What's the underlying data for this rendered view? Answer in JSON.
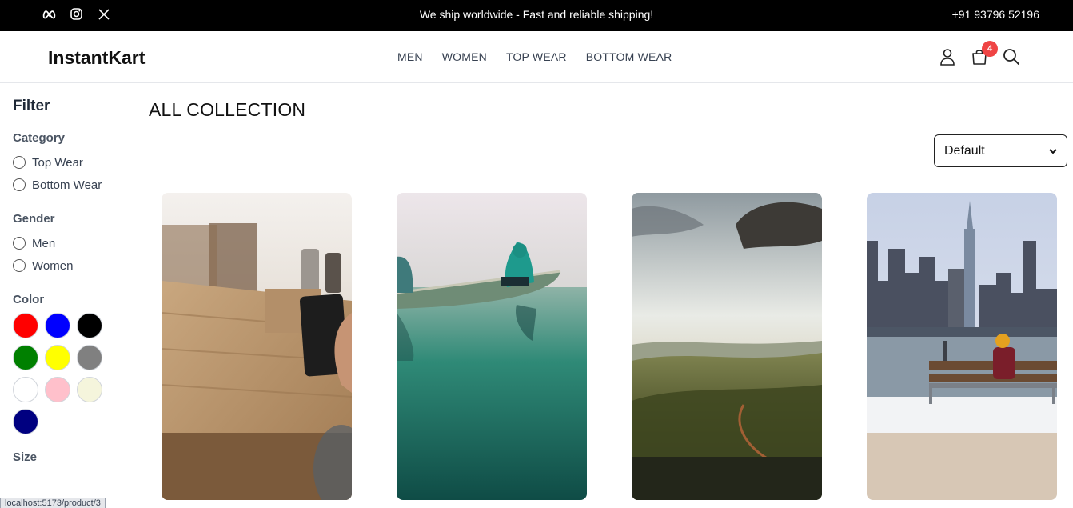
{
  "topbar": {
    "socials": [
      "meta-icon",
      "instagram-icon",
      "x-icon"
    ],
    "promo": "We ship worldwide - Fast and reliable shipping!",
    "phone": "+91 93796 52196"
  },
  "header": {
    "brand": "InstantKart",
    "nav": [
      "MEN",
      "WOMEN",
      "TOP WEAR",
      "BOTTOM WEAR"
    ],
    "cart_count": "4"
  },
  "filter": {
    "title": "Filter",
    "category": {
      "label": "Category",
      "options": [
        "Top Wear",
        "Bottom Wear"
      ]
    },
    "gender": {
      "label": "Gender",
      "options": [
        "Men",
        "Women"
      ]
    },
    "color": {
      "label": "Color",
      "swatches": [
        "#ff0000",
        "#0000ff",
        "#000000",
        "#008000",
        "#ffff00",
        "#808080",
        "#ffffff",
        "#ffc0cb",
        "#f5f5dc",
        "#000080"
      ]
    },
    "size": {
      "label": "Size"
    }
  },
  "main": {
    "title": "ALL COLLECTION",
    "sort_selected": "Default"
  },
  "products": [
    "phone-on-table-image",
    "canoe-on-lake-image",
    "valley-landscape-image",
    "city-skyline-bench-image"
  ],
  "status_url": "localhost:5173/product/3"
}
